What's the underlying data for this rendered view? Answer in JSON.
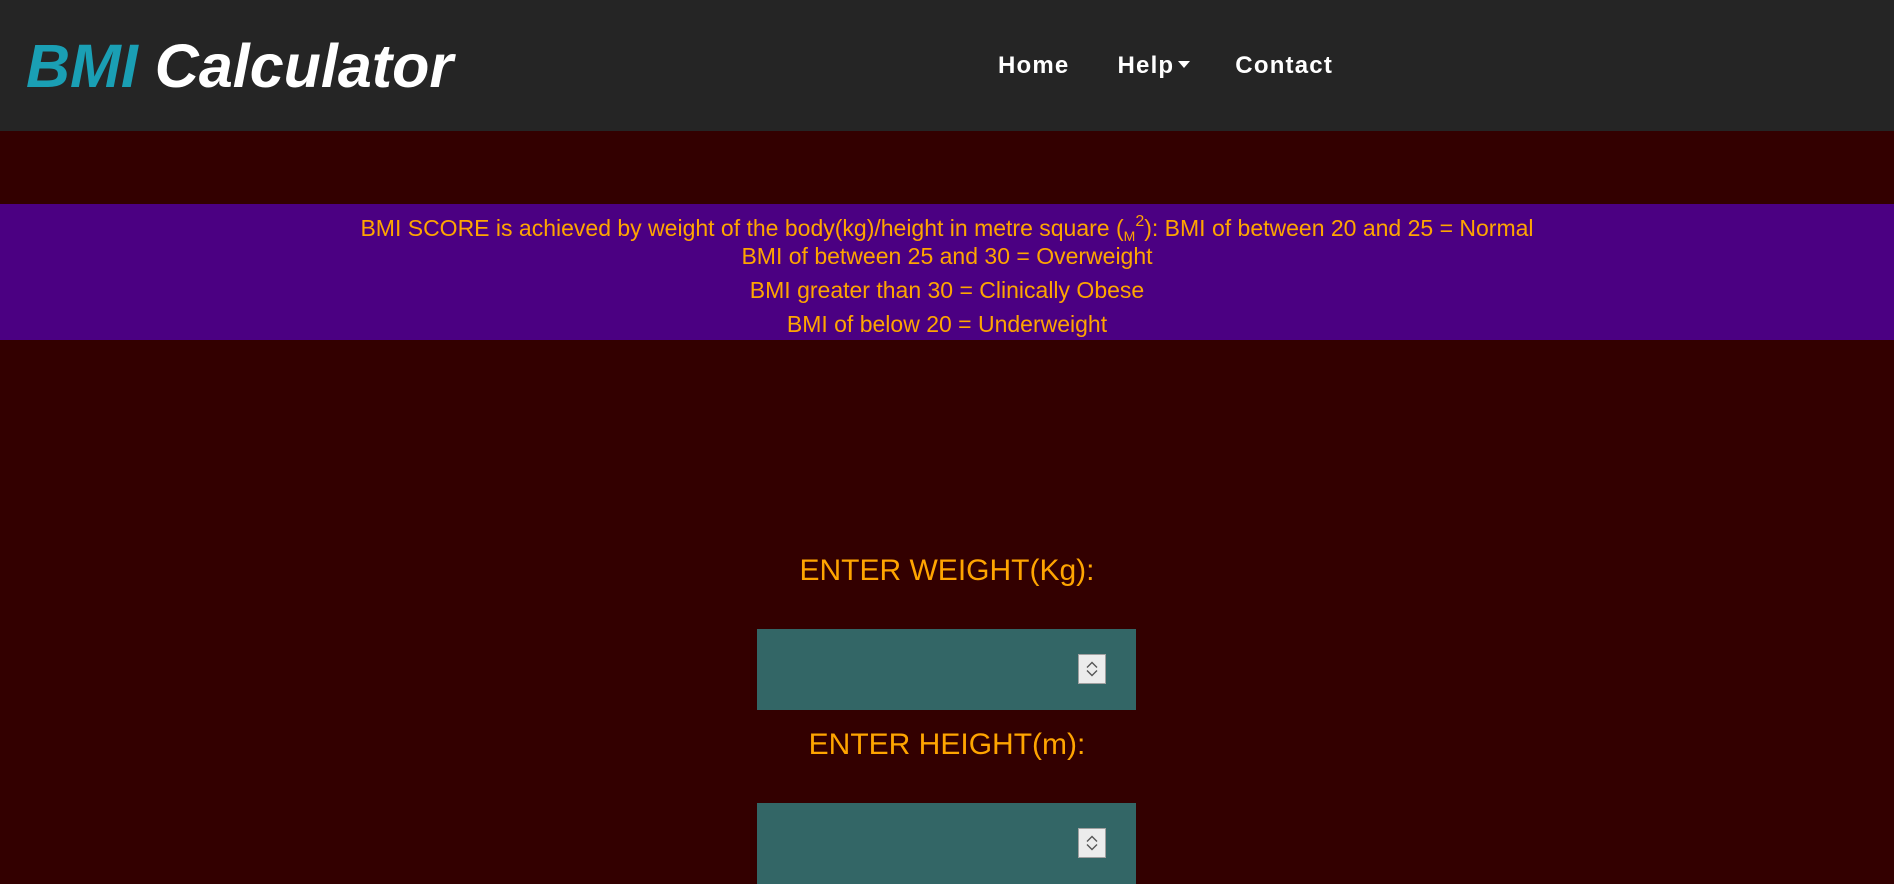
{
  "header": {
    "brand_accent": "BMI",
    "brand_main": "Calculator",
    "nav": {
      "home": "Home",
      "help": "Help",
      "contact": "Contact"
    }
  },
  "info": {
    "line1_prefix": "BMI SCORE is achieved by weight of the body(kg)/height in metre square (",
    "line1_unit": "M",
    "line1_exp": "2",
    "line1_suffix": "): BMI of between 20 and 25 = Normal",
    "line2": "BMI of between 25 and 30 = Overweight",
    "line3": "BMI greater than 30 = Clinically Obese",
    "line4": "BMI of below 20 = Underweight"
  },
  "form": {
    "weight_label": "ENTER WEIGHT(Kg):",
    "weight_value": "",
    "height_label": "ENTER HEIGHT(m):",
    "height_value": ""
  },
  "colors": {
    "page_bg": "#330000",
    "navbar_bg": "#252525",
    "brand_accent": "#1a9fb4",
    "info_band_bg": "#4b0082",
    "text_orange": "#ffa500",
    "input_bg": "#336666"
  },
  "icons": {
    "help_caret": "caret-down-icon",
    "spinner_up": "chevron-up-icon",
    "spinner_down": "chevron-down-icon"
  }
}
